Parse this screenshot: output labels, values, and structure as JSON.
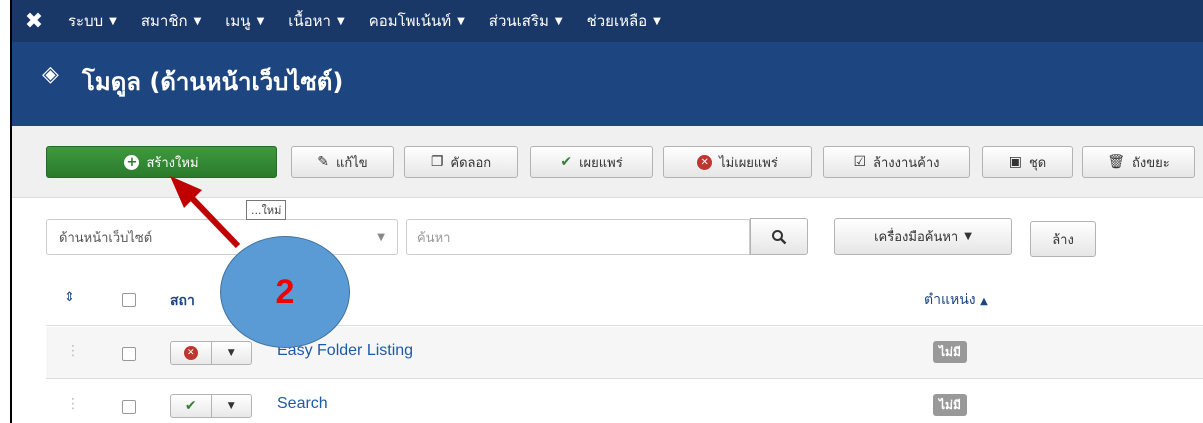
{
  "nav": {
    "logo_icon": "joomla-logo",
    "items": [
      {
        "label": "ระบบ"
      },
      {
        "label": "สมาชิก"
      },
      {
        "label": "เมนู"
      },
      {
        "label": "เนื้อหา"
      },
      {
        "label": "คอมโพเน้นท์"
      },
      {
        "label": "ส่วนเสริม"
      },
      {
        "label": "ช่วยเหลือ"
      }
    ]
  },
  "header": {
    "icon": "cube-icon",
    "title": "โมดูล (ด้านหน้าเว็บไซต์)"
  },
  "toolbar": {
    "new": "สร้างใหม่",
    "edit": "แก้ไข",
    "copy": "คัดลอก",
    "publish": "เผยแพร่",
    "unpublish": "ไม่เผยแพร่",
    "checkin": "ล้างงานค้าง",
    "batch": "ชุด",
    "trash": "ถังขยะ"
  },
  "tooltip": {
    "text": "...ใหม่"
  },
  "filters": {
    "client_value": "ด้านหน้าเว็บไซต์",
    "search_placeholder": "ค้นหา",
    "search_tools": "เครื่องมือค้นหา",
    "clear": "ล้าง"
  },
  "table": {
    "col_status": "สถา",
    "col_position": "ตำแหน่ง",
    "rows": [
      {
        "title": "Easy Folder Listing",
        "published": false,
        "position": "ไม่มี"
      },
      {
        "title": "Search",
        "published": true,
        "position": "ไม่มี"
      }
    ]
  },
  "annotation": {
    "step": "2",
    "color": "#5a9bd5",
    "arrow_color": "#c00000"
  },
  "colors": {
    "nav": "#1a3867",
    "header": "#1d4680",
    "new_button": "#378137"
  }
}
